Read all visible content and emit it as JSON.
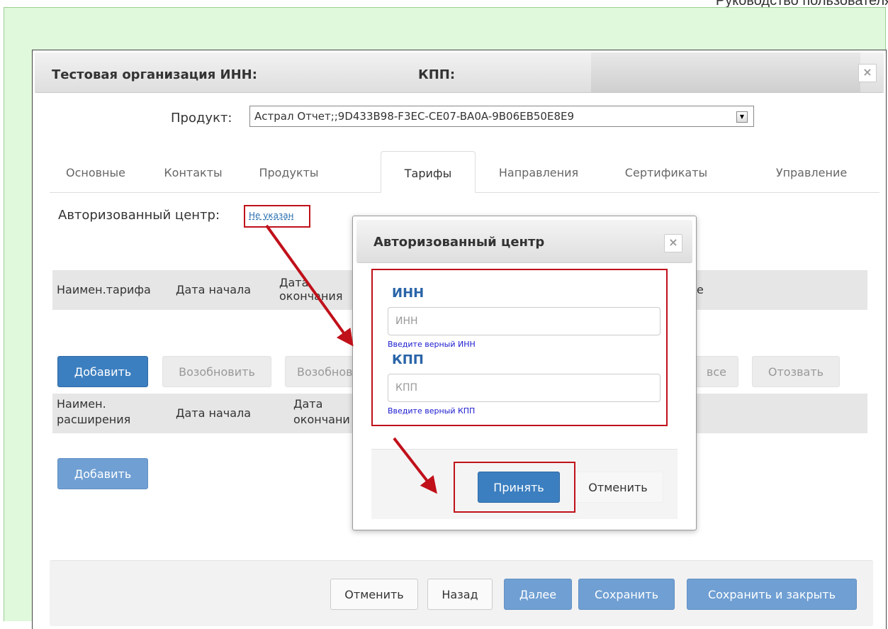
{
  "page": {
    "header_text": "Руководство пользователя"
  },
  "window": {
    "title": "Тестовая организация ИНН:",
    "kpp_label": "КПП:",
    "close_glyph": "×"
  },
  "product": {
    "label": "Продукт:",
    "value": "Астрал Отчет;;9D433B98-F3EC-CE07-BA0A-9B06EB50E8E9"
  },
  "tabs": [
    {
      "label": "Основные"
    },
    {
      "label": "Контакты"
    },
    {
      "label": "Продукты"
    },
    {
      "label": "Тарифы"
    },
    {
      "label": "Направления"
    },
    {
      "label": "Сертификаты"
    },
    {
      "label": "Управление"
    }
  ],
  "active_tab": "Тарифы",
  "auth_center": {
    "label": "Авторизованный центр:",
    "link": "Не указан"
  },
  "tariff_table": {
    "columns": [
      "Наимен.тарифа",
      "Дата начала",
      "Дата окончания",
      "е"
    ]
  },
  "tariff_buttons": [
    "Добавить",
    "Возобновить",
    "Возобнов",
    "все",
    "Отозвать"
  ],
  "extension_table": {
    "columns": [
      "Наимен. расширения",
      "Дата начала",
      "Дата окончани"
    ]
  },
  "extension_add": "Добавить",
  "footer_buttons": [
    "Отменить",
    "Назад",
    "Далее",
    "Сохранить",
    "Сохранить и закрыть"
  ],
  "dialog": {
    "title": "Авторизованный центр",
    "close_glyph": "×",
    "inn": {
      "label": "ИНН",
      "placeholder": "ИНН",
      "hint": "Введите верный ИНН"
    },
    "kpp": {
      "label": "КПП",
      "placeholder": "КПП",
      "hint": "Введите верный КПП"
    },
    "accept": "Принять",
    "cancel": "Отменить"
  },
  "colors": {
    "frame_bg": "#e0f8dc",
    "primary": "#3c7fc0",
    "highlight": "#c0101a",
    "label_blue": "#2a64a8",
    "hint_blue": "#1a1ad0"
  }
}
